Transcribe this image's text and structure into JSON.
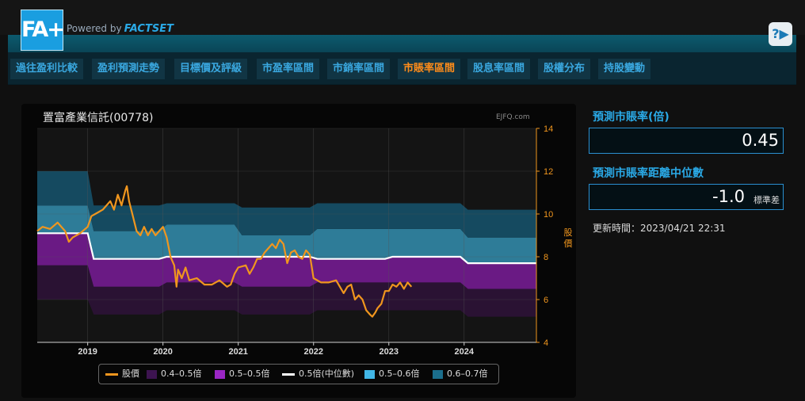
{
  "header": {
    "logo_text": "FA+",
    "powered_by": "Powered by",
    "brand": "FACTSET",
    "help_icon": "help-play-icon"
  },
  "tabs": [
    {
      "label": "過往盈利比較",
      "active": false
    },
    {
      "label": "盈利預測走勢",
      "active": false
    },
    {
      "label": "目標價及評級",
      "active": false
    },
    {
      "label": "市盈率區間",
      "active": false
    },
    {
      "label": "市銷率區間",
      "active": false
    },
    {
      "label": "市賬率區間",
      "active": true
    },
    {
      "label": "股息率區間",
      "active": false
    },
    {
      "label": "股權分布",
      "active": false
    },
    {
      "label": "持股變動",
      "active": false
    }
  ],
  "chart": {
    "title": "置富產業信託(00778)",
    "watermark": "EJFQ.com",
    "y_axis_label": "股價"
  },
  "right_panel": {
    "pb_label": "預測市賬率(倍)",
    "pb_value": "0.45",
    "dist_label": "預測市賬率距離中位數",
    "dist_value": "-1.0",
    "dist_unit": "標準差",
    "updated": "更新時間：2023/04/21 22:31"
  },
  "colors": {
    "price": "#f0961e",
    "band_04_05": "#3d1450",
    "band_05_05": "#6a1a84",
    "median": "#ffffff",
    "band_05_06": "#2e7c98",
    "band_06_07": "#154a60",
    "band_low": "#2a1233",
    "accent": "#2aa9e6",
    "tab_active": "#ff8c1a"
  },
  "chart_data": {
    "type": "area",
    "y_ticks": [
      4,
      6,
      8,
      10,
      12,
      14
    ],
    "ylim": [
      4,
      14
    ],
    "x_ticks": [
      "2019",
      "2020",
      "2021",
      "2022",
      "2023",
      "2024"
    ],
    "xlim": [
      2018.33,
      2024.96
    ],
    "legend": [
      "股價",
      "0.4–0.5倍",
      "0.5–0.5倍",
      "0.5倍(中位數)",
      "0.5–0.6倍",
      "0.6–0.7倍"
    ],
    "band_x": [
      2018.33,
      2019.0,
      2019.08,
      2019.95,
      2020.05,
      2020.95,
      2021.05,
      2021.95,
      2022.05,
      2022.95,
      2023.05,
      2023.95,
      2024.05,
      2024.96
    ],
    "bands": {
      "b1": [
        6.0,
        6.0,
        5.3,
        5.3,
        5.5,
        5.5,
        5.3,
        5.3,
        5.5,
        5.5,
        5.5,
        5.5,
        5.2,
        5.2
      ],
      "b2": [
        7.6,
        7.6,
        6.6,
        6.6,
        6.8,
        6.8,
        6.6,
        6.6,
        6.8,
        6.8,
        6.8,
        6.8,
        6.5,
        6.5
      ],
      "median": [
        9.1,
        9.1,
        7.9,
        7.9,
        8.0,
        8.0,
        8.0,
        8.0,
        7.9,
        7.9,
        8.0,
        8.0,
        7.7,
        7.7
      ],
      "b4": [
        10.4,
        10.4,
        9.2,
        9.2,
        9.5,
        9.5,
        9.0,
        9.0,
        9.3,
        9.3,
        9.3,
        9.3,
        8.9,
        8.9
      ],
      "b5": [
        12.0,
        12.0,
        10.4,
        10.4,
        10.5,
        10.5,
        10.3,
        10.3,
        10.5,
        10.5,
        10.5,
        10.5,
        10.2,
        10.2
      ]
    },
    "price": {
      "x": [
        2018.33,
        2018.4,
        2018.5,
        2018.6,
        2018.7,
        2018.75,
        2018.8,
        2018.9,
        2019.0,
        2019.05,
        2019.1,
        2019.2,
        2019.3,
        2019.35,
        2019.4,
        2019.45,
        2019.5,
        2019.52,
        2019.55,
        2019.6,
        2019.65,
        2019.7,
        2019.75,
        2019.8,
        2019.85,
        2019.9,
        2019.95,
        2020.0,
        2020.05,
        2020.1,
        2020.15,
        2020.18,
        2020.2,
        2020.25,
        2020.3,
        2020.35,
        2020.45,
        2020.55,
        2020.65,
        2020.75,
        2020.85,
        2020.9,
        2020.95,
        2021.0,
        2021.1,
        2021.15,
        2021.2,
        2021.25,
        2021.3,
        2021.35,
        2021.45,
        2021.5,
        2021.55,
        2021.6,
        2021.65,
        2021.7,
        2021.75,
        2021.8,
        2021.85,
        2021.9,
        2021.95,
        2022.0,
        2022.1,
        2022.15,
        2022.2,
        2022.3,
        2022.4,
        2022.45,
        2022.5,
        2022.55,
        2022.6,
        2022.65,
        2022.7,
        2022.75,
        2022.78,
        2022.82,
        2022.85,
        2022.9,
        2022.95,
        2023.0,
        2023.05,
        2023.1,
        2023.15,
        2023.2,
        2023.25,
        2023.3
      ],
      "y": [
        9.2,
        9.4,
        9.3,
        9.6,
        9.2,
        8.7,
        8.9,
        9.1,
        9.4,
        9.9,
        10.0,
        10.2,
        10.6,
        10.2,
        10.9,
        10.4,
        11.1,
        11.3,
        10.6,
        9.9,
        9.2,
        9.0,
        9.4,
        9.0,
        9.3,
        9.0,
        9.2,
        9.4,
        8.9,
        8.0,
        7.6,
        6.6,
        7.4,
        7.0,
        7.5,
        6.9,
        7.0,
        6.7,
        6.7,
        6.9,
        6.6,
        6.7,
        7.2,
        7.5,
        7.6,
        7.2,
        7.5,
        7.9,
        7.9,
        8.2,
        8.6,
        8.4,
        8.8,
        8.6,
        7.7,
        8.2,
        8.3,
        8.0,
        7.9,
        8.3,
        8.1,
        7.0,
        6.8,
        6.8,
        6.8,
        6.9,
        6.3,
        6.6,
        6.7,
        6.0,
        6.2,
        6.0,
        5.5,
        5.3,
        5.2,
        5.4,
        5.6,
        5.8,
        6.4,
        6.4,
        6.7,
        6.6,
        6.8,
        6.5,
        6.8,
        6.6
      ]
    }
  }
}
